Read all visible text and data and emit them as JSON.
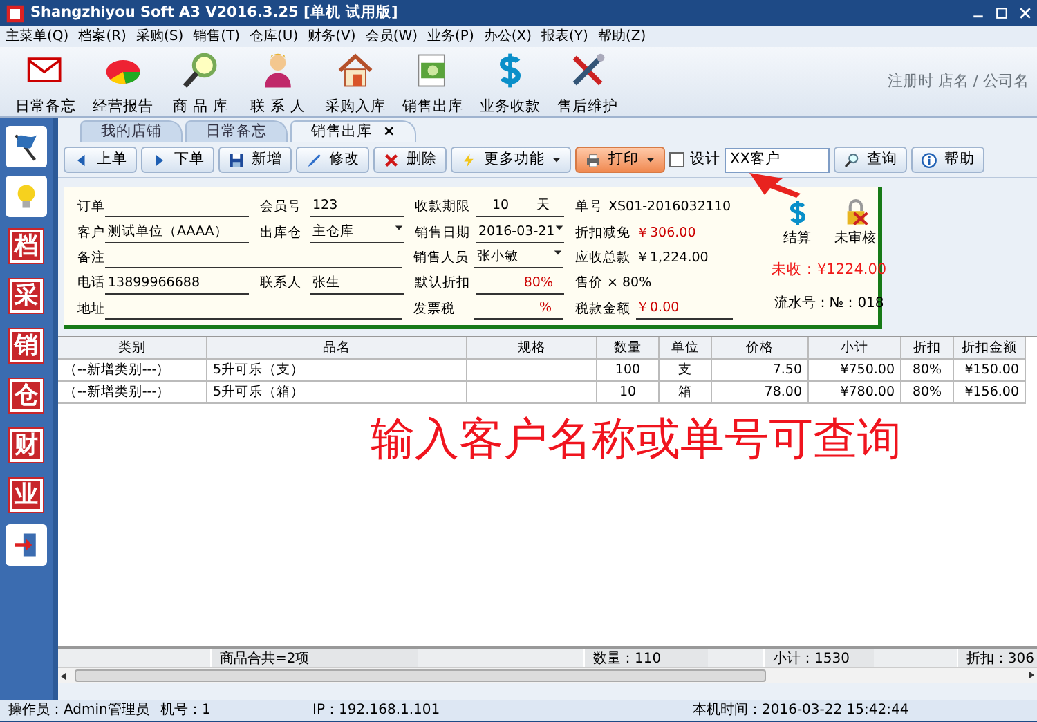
{
  "window": {
    "title": "Shangzhiyou Soft A3 V2016.3.25 [单机 试用版]"
  },
  "menu": [
    "主菜单(Q)",
    "档案(R)",
    "采购(S)",
    "销售(T)",
    "仓库(U)",
    "财务(V)",
    "会员(W)",
    "业务(P)",
    "办公(X)",
    "报表(Y)",
    "帮助(Z)"
  ],
  "toolbar": [
    {
      "label": "日常备忘",
      "kind": "mail"
    },
    {
      "label": "经营报告",
      "kind": "chart"
    },
    {
      "label": "商 品 库",
      "kind": "search"
    },
    {
      "label": "联 系 人",
      "kind": "person"
    },
    {
      "label": "采购入库",
      "kind": "house"
    },
    {
      "label": "销售出库",
      "kind": "money"
    },
    {
      "label": "业务收款",
      "kind": "coin"
    },
    {
      "label": "售后维护",
      "kind": "tools"
    }
  ],
  "registration": "注册时 店名 / 公司名",
  "sidebar": [
    {
      "kind": "flag"
    },
    {
      "kind": "bulb"
    },
    {
      "kind": "stamp",
      "label": "档"
    },
    {
      "kind": "stamp",
      "label": "采"
    },
    {
      "kind": "stamp",
      "label": "销"
    },
    {
      "kind": "stamp",
      "label": "仓"
    },
    {
      "kind": "stamp",
      "label": "财"
    },
    {
      "kind": "stamp",
      "label": "业"
    },
    {
      "kind": "exit"
    }
  ],
  "tabs": [
    {
      "label": "我的店铺",
      "selected": false
    },
    {
      "label": "日常备忘",
      "selected": false
    },
    {
      "label": "销售出库",
      "selected": true,
      "close": "×"
    }
  ],
  "actions": [
    {
      "label": "上单",
      "kind": "prev"
    },
    {
      "label": "下单",
      "kind": "next"
    },
    {
      "label": "新增",
      "kind": "save"
    },
    {
      "label": "修改",
      "kind": "edit"
    },
    {
      "label": "删除",
      "kind": "delete"
    },
    {
      "label": "更多功能",
      "kind": "more",
      "dropdown": true
    },
    {
      "label": "打印",
      "kind": "print",
      "dropdown": true
    }
  ],
  "design": {
    "label": "设计",
    "checked": false
  },
  "search": {
    "value": "XX客户"
  },
  "search_buttons": [
    {
      "label": "查询",
      "kind": "query"
    },
    {
      "label": "帮助",
      "kind": "help"
    }
  ],
  "form": [
    [
      {
        "label": "订单",
        "kind": "text"
      },
      {
        "label": "会员号",
        "value": "123",
        "kind": "text"
      },
      {
        "label": "收款期限",
        "value": "10",
        "suffix": "天",
        "kind": "text"
      }
    ],
    [
      {
        "label": "客户",
        "value": "测试单位（AAAA）",
        "kind": "text"
      },
      {
        "label": "出库仓",
        "value": "主仓库",
        "kind": "select"
      },
      {
        "label": "销售日期",
        "value": "2016-03-21",
        "kind": "select"
      }
    ],
    [
      {
        "label": "备注",
        "kind": "wide"
      },
      {
        "label": "销售人员",
        "value": "张小敏",
        "kind": "select"
      }
    ],
    [
      {
        "label": "电话",
        "value": "13899966688",
        "kind": "text"
      },
      {
        "label": "联系人",
        "value": "张生",
        "kind": "text"
      },
      {
        "label": "默认折扣",
        "value": "80%",
        "kind": "text",
        "highlight": true
      }
    ],
    [
      {
        "label": "地址",
        "kind": "wide"
      },
      {
        "label": "发票税",
        "value": "%",
        "kind": "text",
        "highlight": true
      }
    ]
  ],
  "summary": [
    {
      "label": "单号",
      "value": "XS01-2016032110"
    },
    {
      "label": "折扣减免",
      "value": "￥306.00",
      "highlight": true
    },
    {
      "label": "应收总款",
      "value": "￥1,224.00"
    },
    {
      "label": "售价 × 80%"
    },
    {
      "label": "税款金额",
      "value": "￥0.00",
      "highlight": true,
      "underline": true
    }
  ],
  "status_buttons": [
    {
      "label": "结算",
      "kind": "coin"
    },
    {
      "label": "未审核",
      "kind": "lock"
    }
  ],
  "unpaid": "未收：¥1224.00",
  "serial": "流水号：№：018",
  "table": {
    "columns": [
      "类别",
      "品名",
      "规格",
      "数量",
      "单位",
      "价格",
      "小计",
      "折扣",
      "折扣金额"
    ],
    "rows": [
      [
        "（--新增类别---）",
        "5升可乐（支）",
        "",
        "100",
        "支",
        "7.50",
        "¥750.00",
        "80%",
        "¥150.00"
      ],
      [
        "（--新增类别---）",
        "5升可乐（箱）",
        "",
        "10",
        "箱",
        "78.00",
        "¥780.00",
        "80%",
        "¥156.00"
      ]
    ],
    "footer": [
      "商品合共=2项",
      "数量：110",
      "小计：1530",
      "折扣：306"
    ]
  },
  "annotation": "输入客户名称或单号可查询",
  "status_bar": [
    "操作员：Admin管理员",
    "机号：1",
    "IP：192.168.1.101",
    "本机时间：2016-03-22 15:42:44"
  ]
}
